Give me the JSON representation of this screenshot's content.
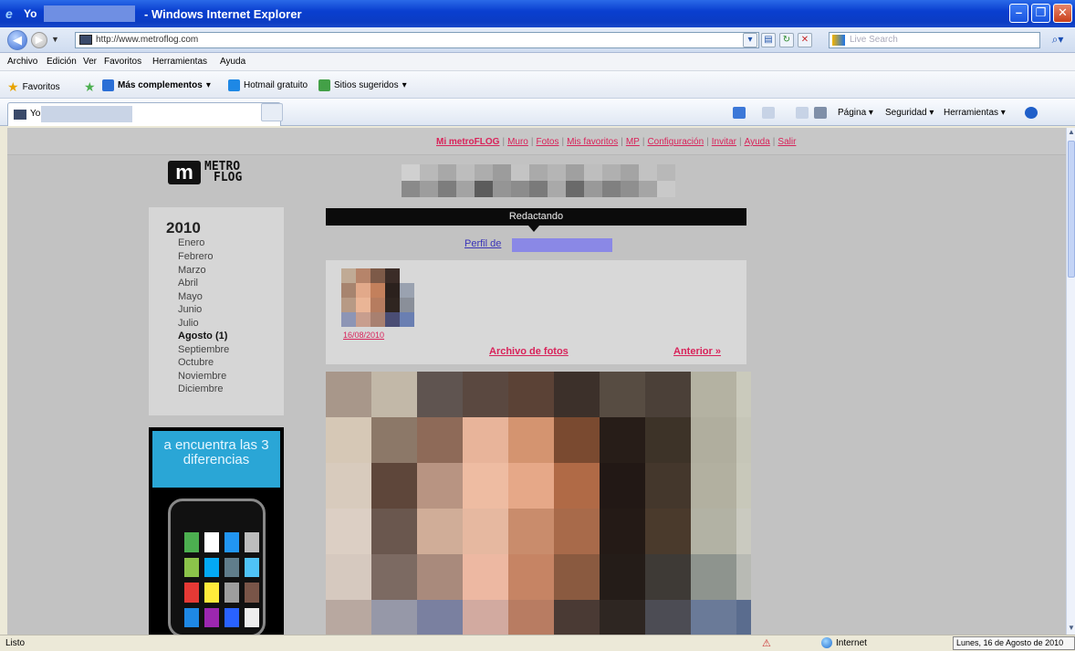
{
  "window": {
    "tab_title": "Yo",
    "title": "- Windows Internet Explorer",
    "colors": {
      "titlebar": "#0b3cc4",
      "accent_link": "#d8235a"
    }
  },
  "address": {
    "url": "http://www.metroflog.com",
    "search_placeholder": "Live Search"
  },
  "menu": {
    "items": [
      "Archivo",
      "Edición",
      "Ver",
      "Favoritos",
      "Herramientas",
      "Ayuda"
    ]
  },
  "favorites": {
    "label": "Favoritos",
    "items": [
      "Más complementos",
      "Hotmail gratuito",
      "Sitios sugeridos"
    ]
  },
  "tabbar": {
    "tab_label": "Yo -"
  },
  "commands": {
    "items": [
      "Página",
      "Seguridad",
      "Herramientas"
    ]
  },
  "site": {
    "nav": [
      "Mi metroFLOG",
      "Muro",
      "Fotos",
      "Mis favoritos",
      "MP",
      "Configuración",
      "Invitar",
      "Ayuda",
      "Salir"
    ],
    "logo_line1": "METRO",
    "logo_line2": "FLOG",
    "logo_mark": "m",
    "redact_label": "Redactando",
    "profile_link": "Perfil de",
    "thumb_date": "16/08/2010",
    "archive_link": "Archivo de fotos",
    "previous_link": "Anterior »",
    "archive": {
      "year": "2010",
      "months": [
        "Enero",
        "Febrero",
        "Marzo",
        "Abril",
        "Mayo",
        "Junio",
        "Julio",
        "Agosto (1)",
        "Septiembre",
        "Octubre",
        "Noviembre",
        "Diciembre"
      ]
    },
    "ad_text": "a encuentra las 3 diferencias"
  },
  "status": {
    "text": "Listo",
    "zone": "Internet",
    "date": "Lunes, 16 de Agosto de 2010"
  }
}
